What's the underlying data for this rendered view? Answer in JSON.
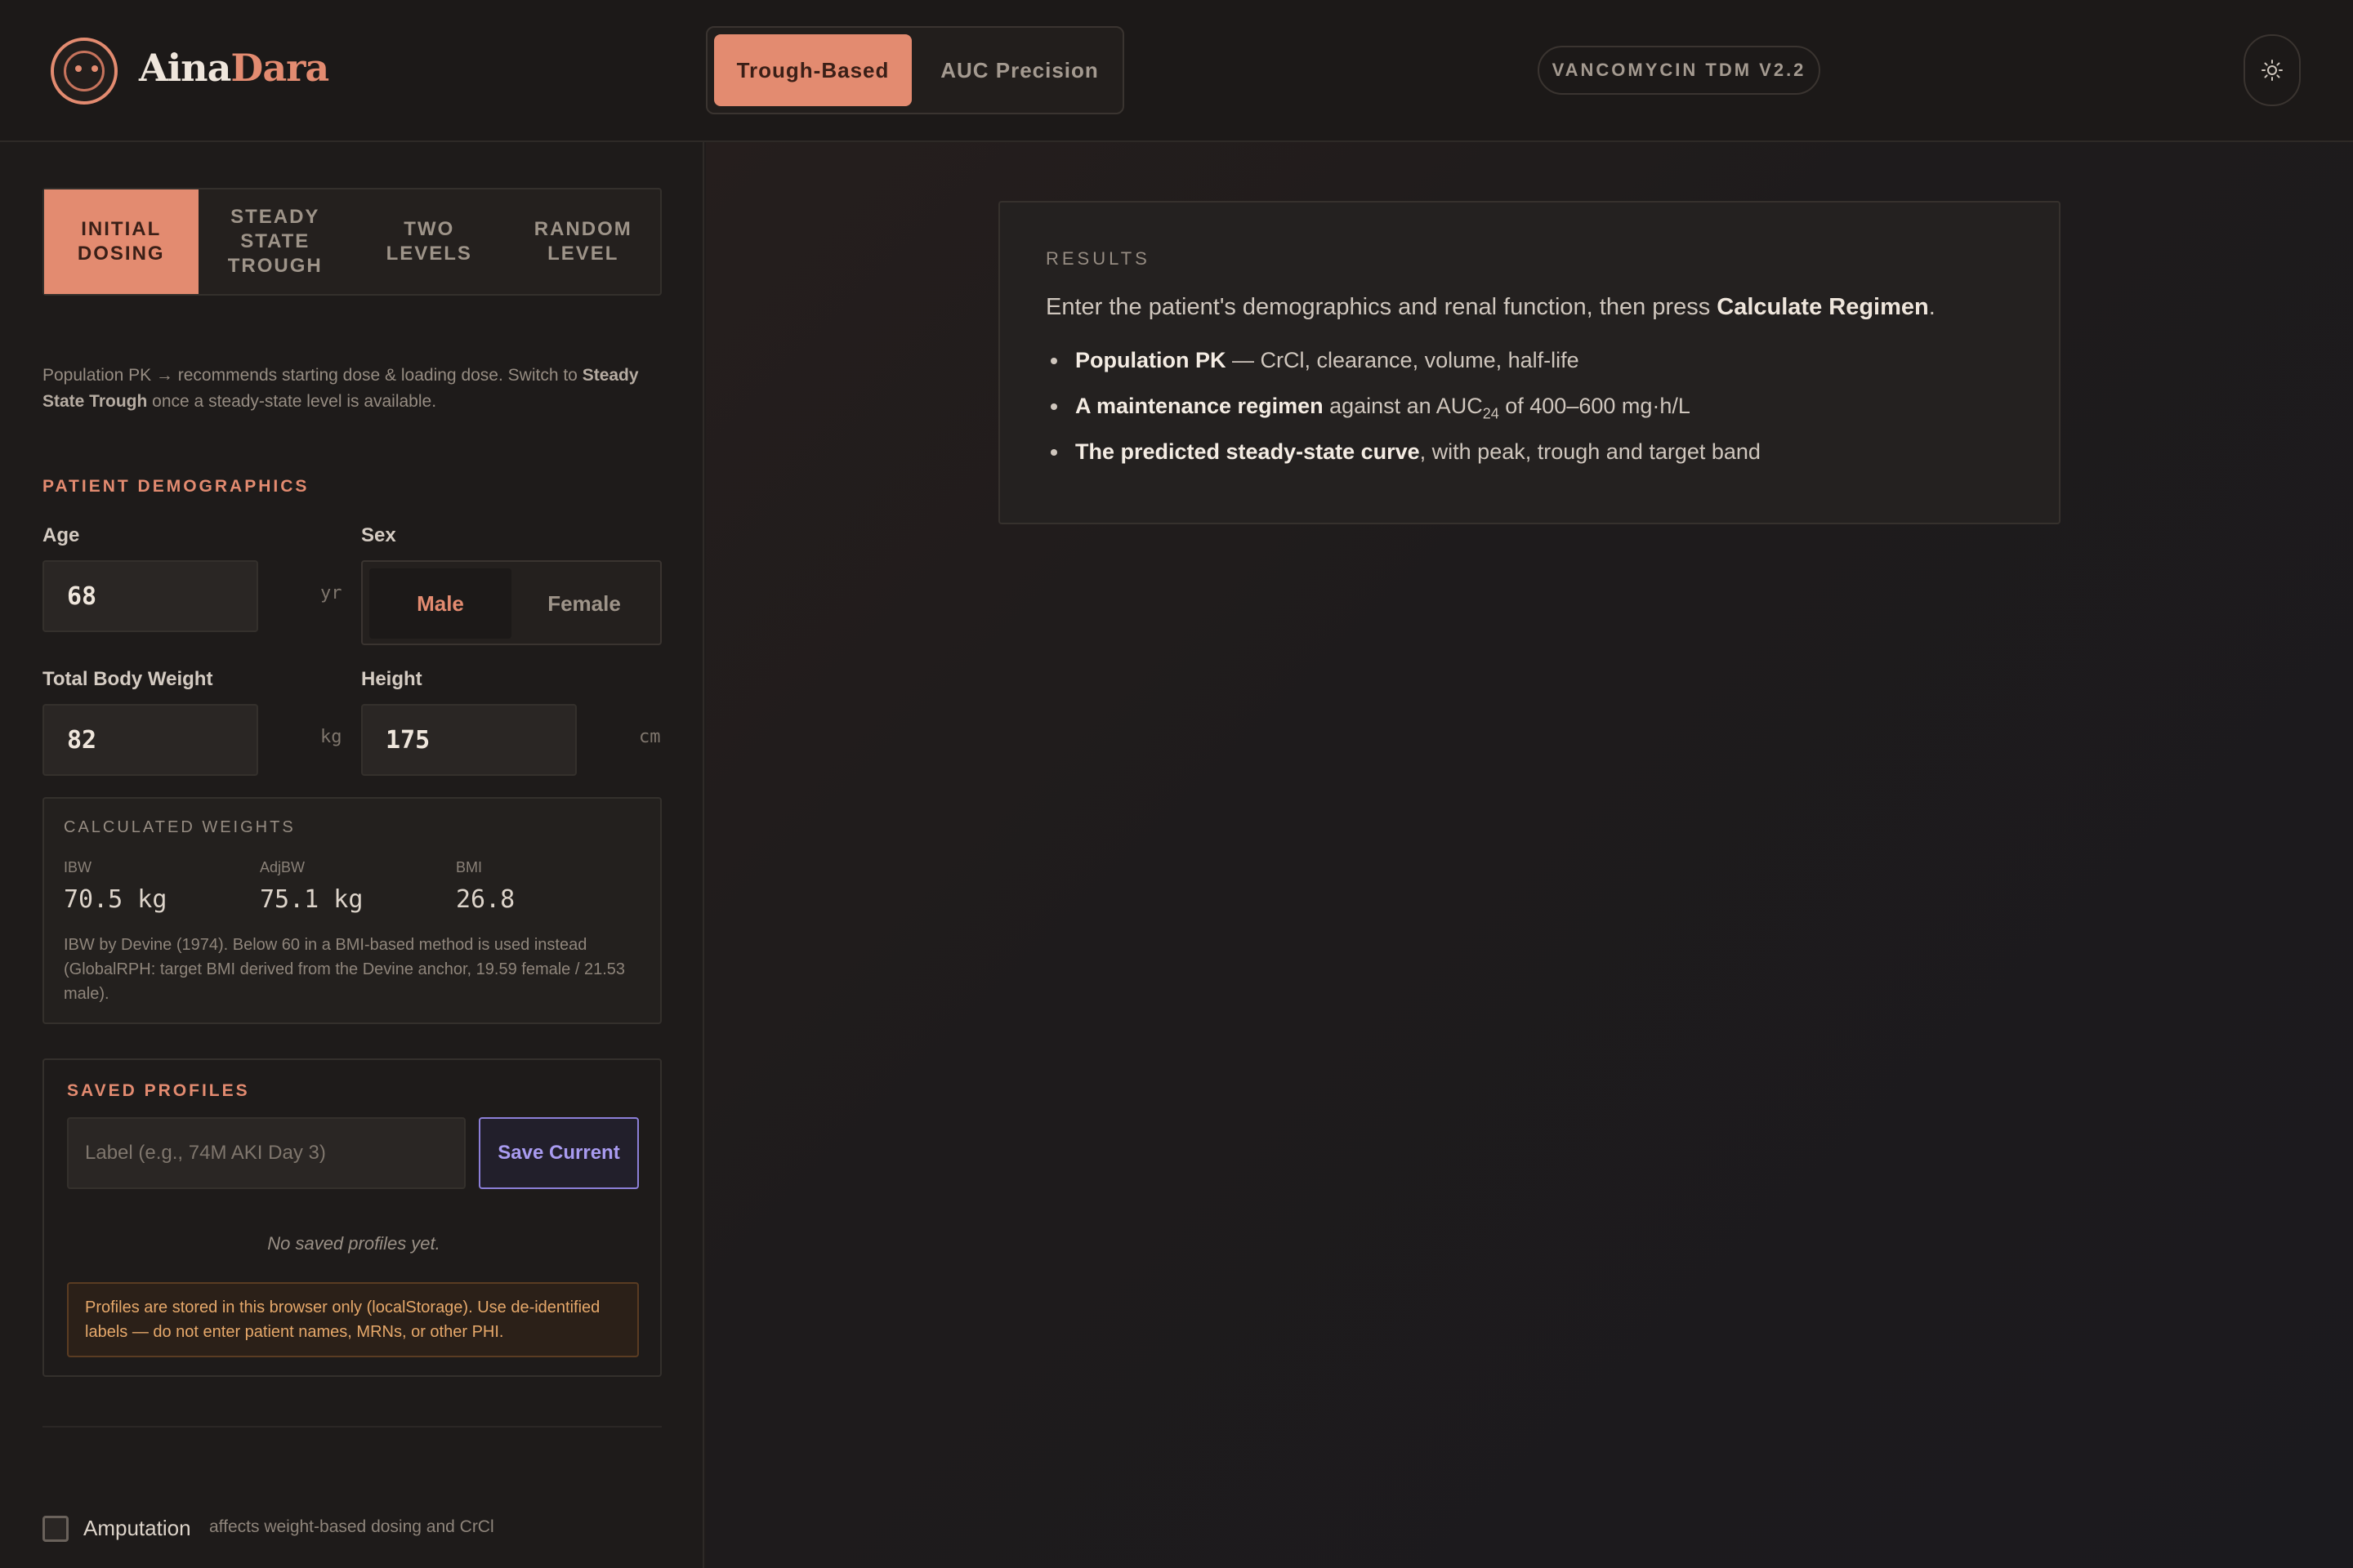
{
  "brand": {
    "name_a": "Aina",
    "name_b": "Dara"
  },
  "mode": {
    "active": "Trough-Based",
    "inactive": "AUC Precision"
  },
  "version": "VANCOMYCIN TDM V2.2",
  "tabs": [
    {
      "label": "INITIAL DOSING",
      "active": true
    },
    {
      "label": "STEADY STATE TROUGH",
      "active": false
    },
    {
      "label": "TWO LEVELS",
      "active": false
    },
    {
      "label": "RANDOM LEVEL",
      "active": false
    }
  ],
  "intro": {
    "part1": "Population PK → recommends starting dose & loading dose. Switch to ",
    "bold": "Steady State Trough",
    "part2": " once a steady-state level is available."
  },
  "demographics": {
    "title": "PATIENT DEMOGRAPHICS",
    "age_label": "Age",
    "age_value": "68",
    "age_unit": "yr",
    "sex_label": "Sex",
    "sex_selected": "Male",
    "sex_other": "Female",
    "weight_label": "Total Body Weight",
    "weight_value": "82",
    "weight_unit": "kg",
    "height_label": "Height",
    "height_value": "175",
    "height_unit": "cm"
  },
  "calculated": {
    "title": "CALCULATED WEIGHTS",
    "ibw_label": "IBW",
    "ibw_value": "70.5 kg",
    "adjbw_label": "AdjBW",
    "adjbw_value": "75.1 kg",
    "bmi_label": "BMI",
    "bmi_value": "26.8",
    "note": "IBW by Devine (1974). Below 60 in a BMI-based method is used instead (GlobalRPH: target BMI derived from the Devine anchor, 19.59 female / 21.53 male)."
  },
  "profiles": {
    "title": "SAVED PROFILES",
    "placeholder": "Label (e.g., 74M AKI Day 3)",
    "save_label": "Save Current",
    "empty": "No saved profiles yet.",
    "warning": "Profiles are stored in this browser only (localStorage). Use de-identified labels — do not enter patient names, MRNs, or other PHI."
  },
  "amputation": {
    "label": "Amputation",
    "note": "affects weight-based dosing and CrCl",
    "checked": false
  },
  "results": {
    "title": "RESULTS",
    "intro_a": "Enter the patient's demographics and renal function, then press ",
    "intro_b": "Calculate Regimen",
    "intro_c": ".",
    "b1_bold": "Population PK",
    "b1_rest": " — CrCl, clearance, volume, half-life",
    "b2_bold": "A maintenance regimen",
    "b2_mid": " against an AUC",
    "b2_sub": "24",
    "b2_rest": " of 400–600 mg·h/L",
    "b3_bold": "The predicted steady-state curve",
    "b3_rest": ", with peak, trough and target band"
  },
  "colors": {
    "accent": "#e38b70",
    "save_accent": "#8c7fd8",
    "warning": "#e6a86a"
  }
}
